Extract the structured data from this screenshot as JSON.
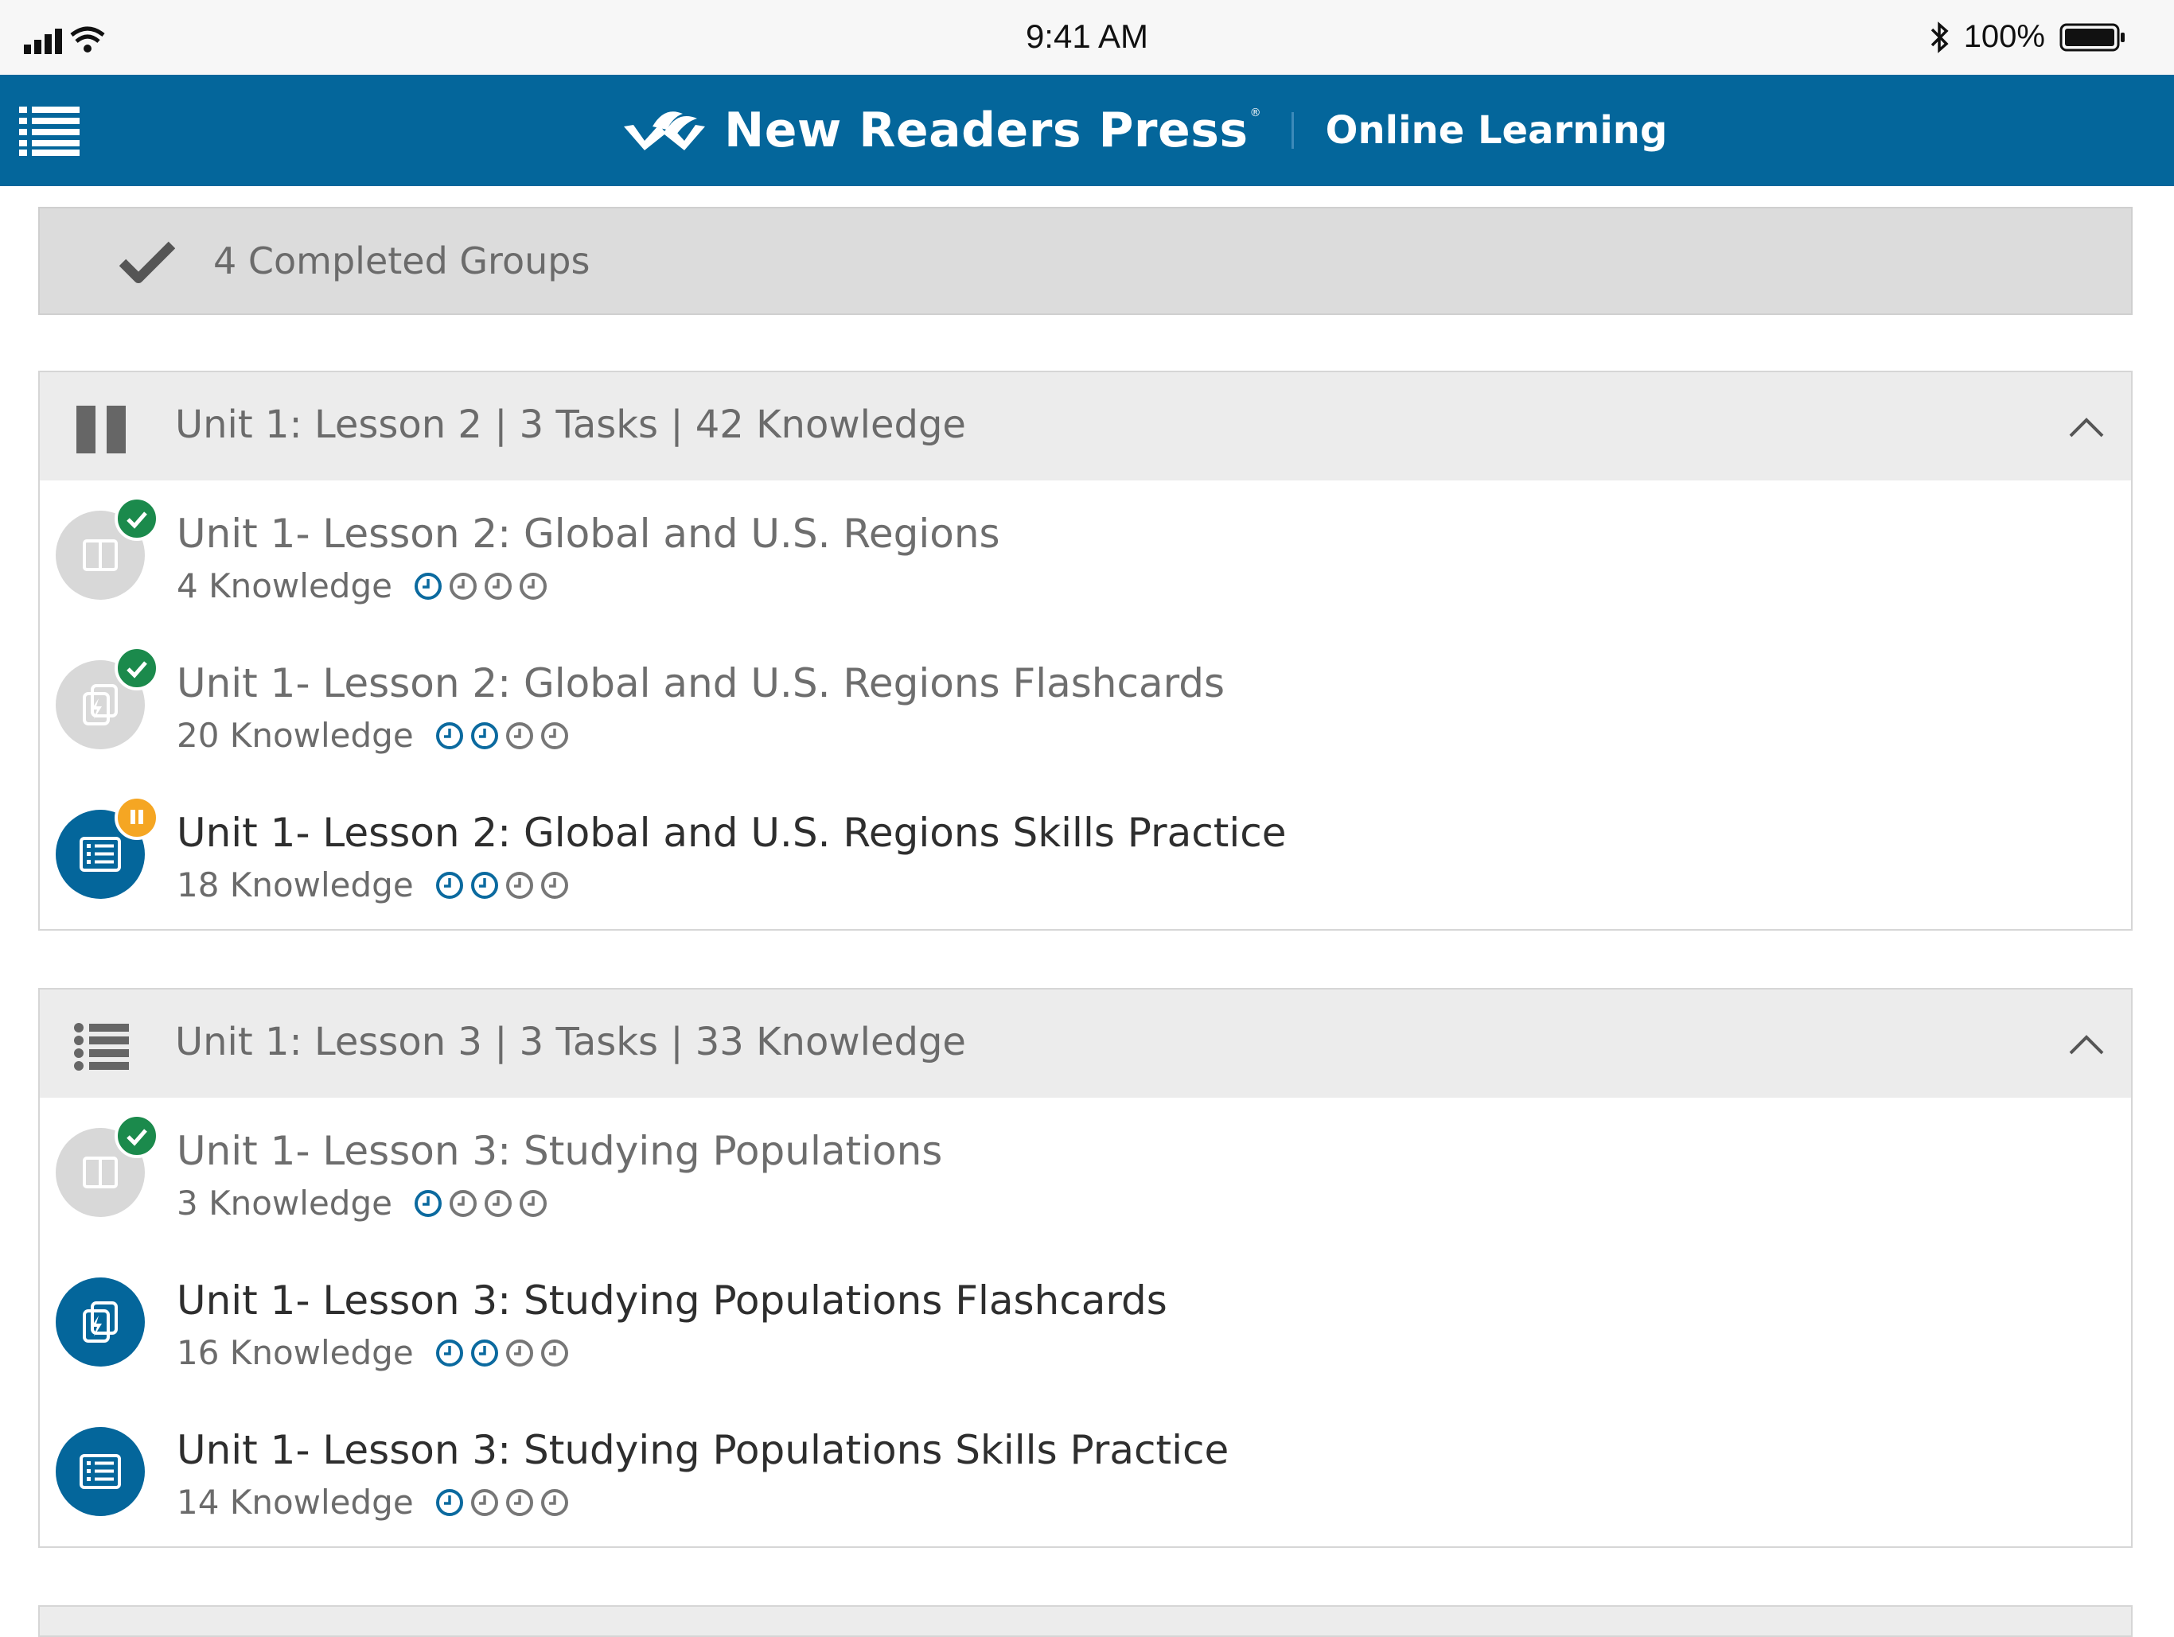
{
  "status_bar": {
    "time": "9:41 AM",
    "battery": "100%"
  },
  "header": {
    "brand": "New Readers Press",
    "brand_mark": "®",
    "subtitle": "Online Learning"
  },
  "completed": {
    "label": "4 Completed Groups"
  },
  "groups": [
    {
      "title": "Unit 1: Lesson 2 | 3 Tasks | 42 Knowledge",
      "icon": "pause-icon",
      "tasks": [
        {
          "title": "Unit 1- Lesson 2: Global and U.S. Regions",
          "knowledge": "4 Knowledge",
          "type": "reading",
          "state": "completed",
          "progress_filled": 1
        },
        {
          "title": "Unit 1- Lesson 2: Global and U.S. Regions Flashcards",
          "knowledge": "20 Knowledge",
          "type": "flashcards",
          "state": "completed",
          "progress_filled": 2
        },
        {
          "title": "Unit 1- Lesson 2: Global and U.S. Regions Skills Practice",
          "knowledge": "18 Knowledge",
          "type": "practice",
          "state": "paused",
          "progress_filled": 2
        }
      ]
    },
    {
      "title": "Unit 1: Lesson 3 | 3 Tasks | 33 Knowledge",
      "icon": "list-icon",
      "tasks": [
        {
          "title": "Unit 1- Lesson 3: Studying Populations",
          "knowledge": "3 Knowledge",
          "type": "reading",
          "state": "completed",
          "progress_filled": 1
        },
        {
          "title": "Unit 1- Lesson 3: Studying Populations Flashcards",
          "knowledge": "16 Knowledge",
          "type": "flashcards",
          "state": "available",
          "progress_filled": 2
        },
        {
          "title": "Unit 1- Lesson 3: Studying Populations Skills Practice",
          "knowledge": "14 Knowledge",
          "type": "practice",
          "state": "available",
          "progress_filled": 1
        }
      ]
    }
  ],
  "colors": {
    "brand_blue": "#04669b",
    "complete_green": "#1b8a4c",
    "paused_orange": "#f5a623",
    "inactive_gray": "#d8d8d8"
  }
}
